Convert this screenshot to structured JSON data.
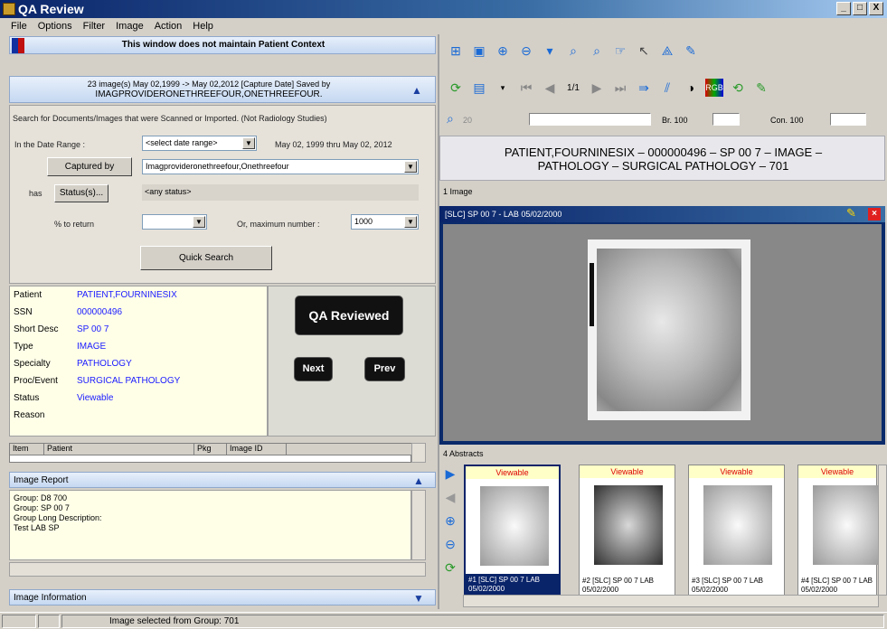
{
  "window": {
    "title": "QA Review",
    "buttons": [
      "_",
      "□",
      "X"
    ]
  },
  "menu": [
    "File",
    "Options",
    "Filter",
    "Image",
    "Action",
    "Help"
  ],
  "left": {
    "context_warning": "This window does not maintain Patient Context",
    "capture_summary_line1": "23 image(s) May 02,1999 -> May 02,2012  [Capture Date] Saved by",
    "capture_summary_line2": "IMAGPROVIDERONETHREEFOUR,ONETHREEFOUR.",
    "search_desc": "Search for Documents/Images that were Scanned or Imported.  (Not Radiology Studies)",
    "date_range_label": "In the Date Range :",
    "date_range_value": "<select date range>",
    "date_range_text": "May 02, 1999 thru May 02, 2012",
    "captured_by_button": "Captured by",
    "captured_by_value": "Imagprovideronethreefour,Onethreefour",
    "has_label": "has",
    "status_button": "Status(s)...",
    "status_value": "<any status>",
    "percent_label": "% to return",
    "percent_value": "",
    "max_label": "Or, maximum number :",
    "max_value": "1000",
    "quick_search_button": "Quick Search",
    "info": [
      {
        "k": "Patient",
        "v": "PATIENT,FOURNINESIX"
      },
      {
        "k": "SSN",
        "v": "000000496"
      },
      {
        "k": "Short Desc",
        "v": "SP 00 7"
      },
      {
        "k": "Type",
        "v": "IMAGE"
      },
      {
        "k": "Specialty",
        "v": "PATHOLOGY"
      },
      {
        "k": "Proc/Event",
        "v": "SURGICAL PATHOLOGY"
      },
      {
        "k": "Status",
        "v": "Viewable"
      },
      {
        "k": "Reason",
        "v": ""
      }
    ],
    "qa_reviewed_button": "QA Reviewed",
    "next_button": "Next",
    "prev_button": "Prev",
    "grid_headers": [
      "Item",
      "Patient",
      "",
      "Pkg",
      "Image ID"
    ],
    "image_report_title": "Image Report",
    "image_report_lines": [
      "Group: D8 700",
      "Group:  SP 00 7",
      "Group Long Description:",
      "Test LAB SP"
    ],
    "image_info_title": "Image Information"
  },
  "right": {
    "zoom_value": "20",
    "brightness_label": "Br. 100",
    "contrast_label": "Con. 100",
    "page_indicator": "1/1",
    "header_line1": "PATIENT,FOURNINESIX – 000000496 – SP 00 7 – IMAGE –",
    "header_line2": "PATHOLOGY – SURGICAL PATHOLOGY – 701",
    "image_count": "1 Image",
    "viewer_caption": "[SLC] SP 00 7 - LAB 05/02/2000",
    "abstracts_label": "4 Abstracts",
    "thumbs": [
      {
        "status": "Viewable",
        "cap": "#1 [SLC] SP 00 7 LAB 05/02/2000",
        "selected": true
      },
      {
        "status": "Viewable",
        "cap": "#2 [SLC] SP 00 7 LAB 05/02/2000",
        "selected": false
      },
      {
        "status": "Viewable",
        "cap": "#3 [SLC] SP 00 7 LAB 05/02/2000",
        "selected": false
      },
      {
        "status": "Viewable",
        "cap": "#4 [SLC] SP 00 7 LAB 05/02/2000",
        "selected": false
      }
    ]
  },
  "status_bar": {
    "message": "Image selected from Group: 701"
  }
}
